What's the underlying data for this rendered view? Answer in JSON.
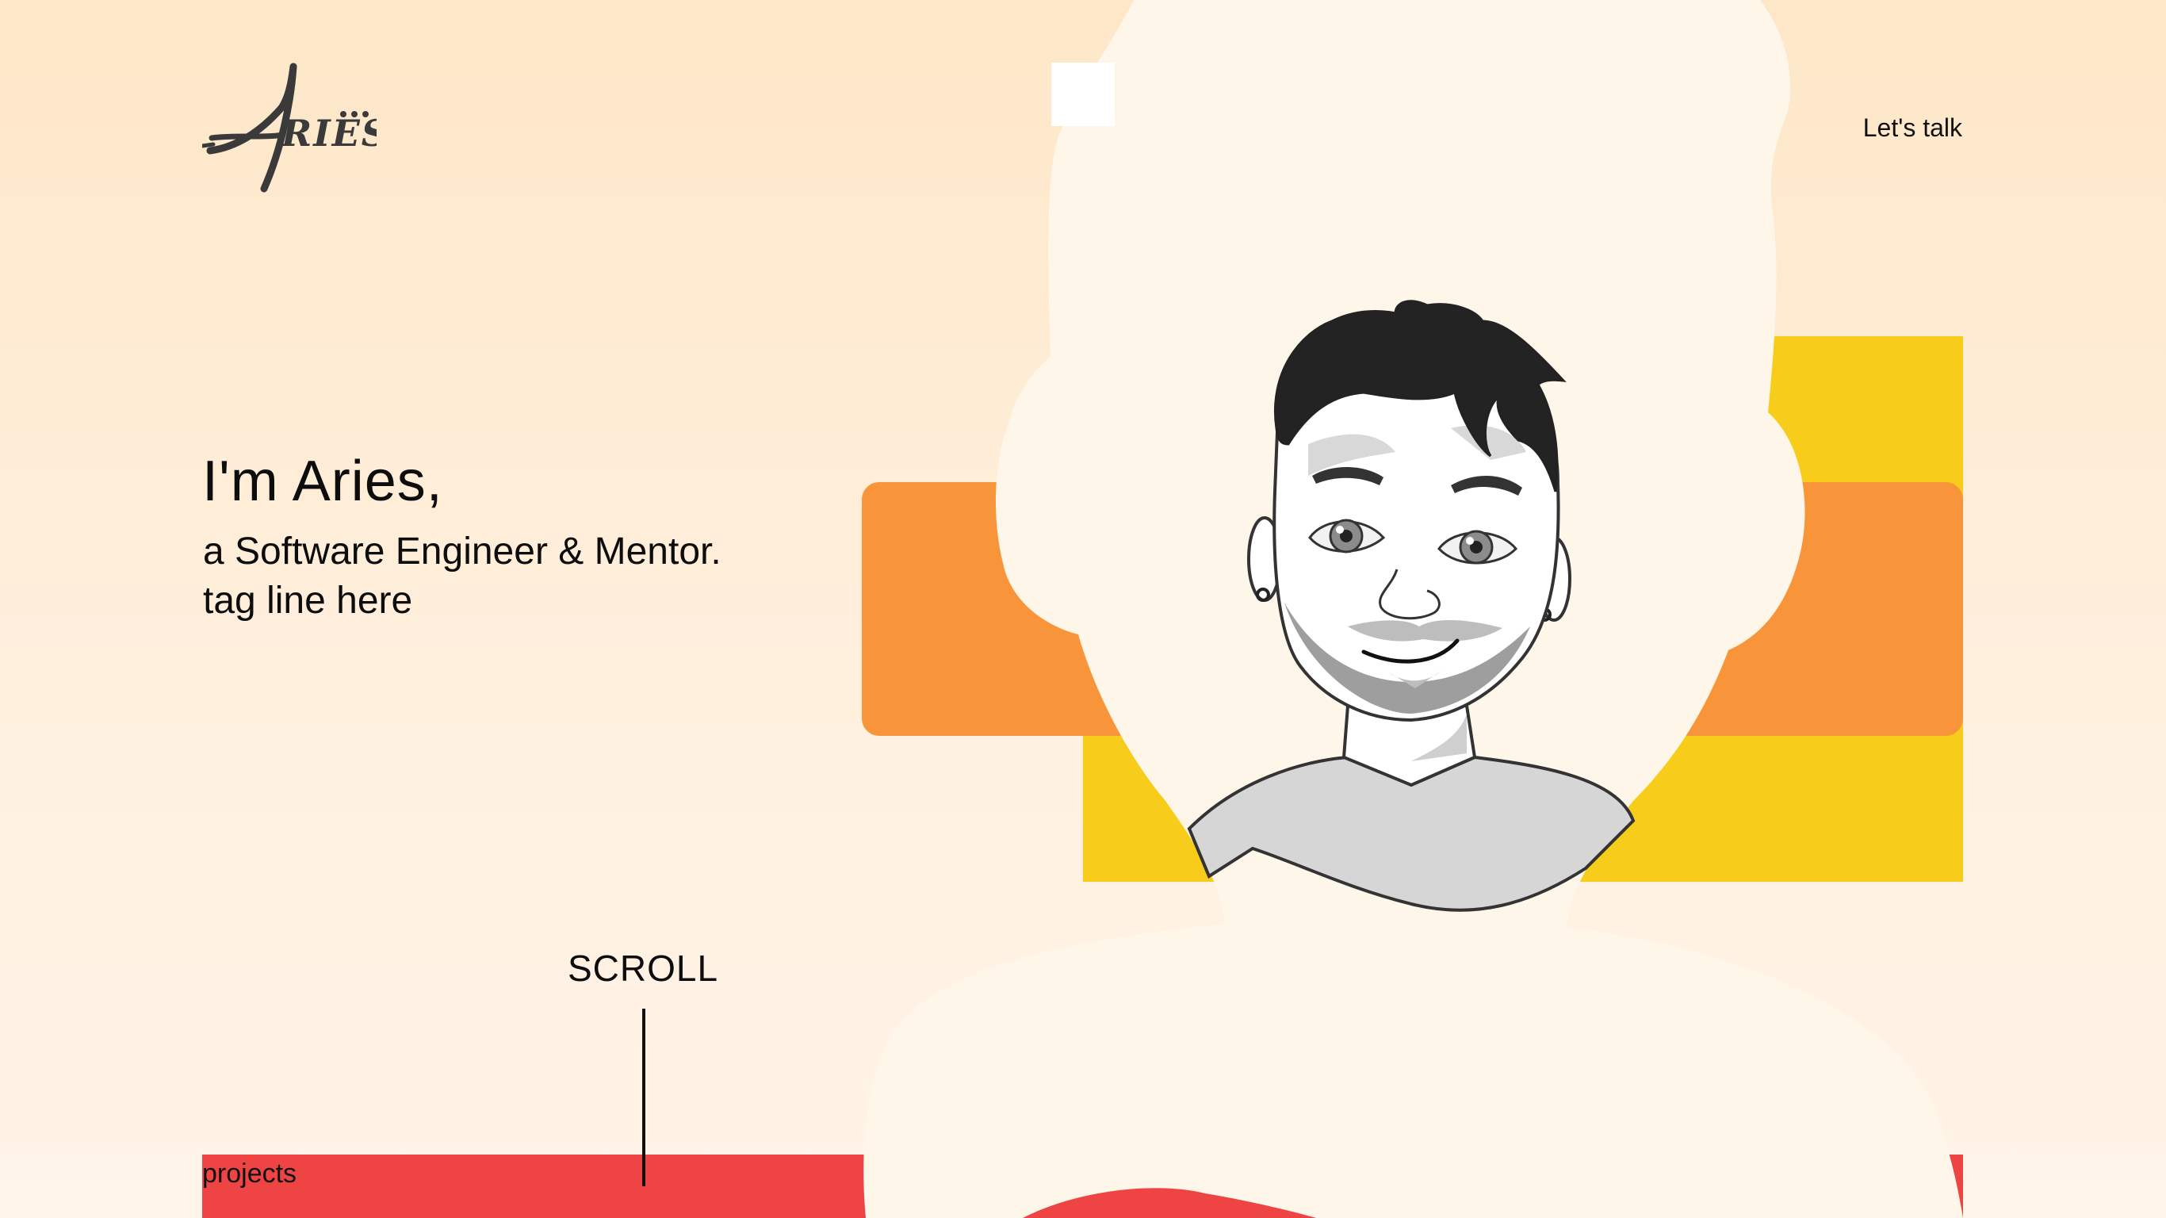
{
  "header": {
    "logo_text": "Aries",
    "cta_label": "Let's talk"
  },
  "hero": {
    "title": "I'm Aries,",
    "subtitle": "a Software Engineer & Mentor.",
    "tagline": "tag line here"
  },
  "scroll": {
    "label": "SCROLL"
  },
  "projects": {
    "label": "projects"
  },
  "colors": {
    "background_top": "#fee7c8",
    "background_bottom": "#fff4e8",
    "accent_yellow": "#f8cc1b",
    "accent_orange": "#f8953a",
    "accent_red": "#ef4444",
    "silhouette": "#fff6ea"
  }
}
